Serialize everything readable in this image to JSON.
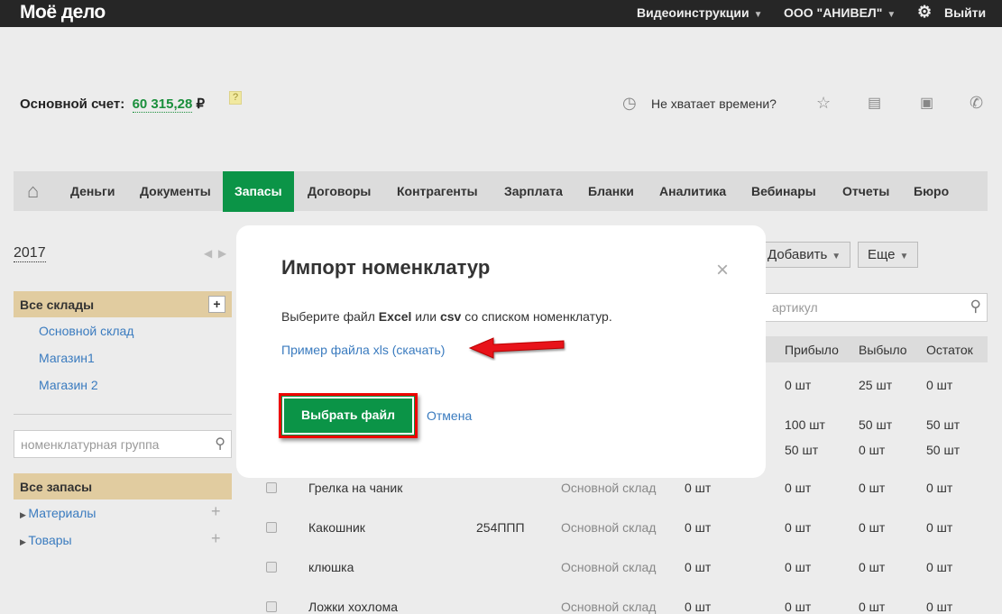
{
  "topbar": {
    "logo": "Моё дело",
    "video": "Видеоинструкции",
    "company": "ООО \"АНИВЕЛ\"",
    "logout": "Выйти"
  },
  "account": {
    "label": "Основной счет:",
    "amount": "60 315,28",
    "currency": "₽",
    "help": "?",
    "no_time": "Не хватает времени?"
  },
  "nav": [
    {
      "label": "Деньги"
    },
    {
      "label": "Документы"
    },
    {
      "label": "Запасы",
      "active": true
    },
    {
      "label": "Договоры"
    },
    {
      "label": "Контрагенты"
    },
    {
      "label": "Зарплата"
    },
    {
      "label": "Бланки"
    },
    {
      "label": "Аналитика"
    },
    {
      "label": "Вебинары"
    },
    {
      "label": "Отчеты"
    },
    {
      "label": "Бюро"
    }
  ],
  "sidebar": {
    "year": "2017",
    "warehouses_title": "Все склады",
    "warehouses": [
      "Основной склад",
      "Магазин1",
      "Магазин 2"
    ],
    "group_placeholder": "номенклатурная группа",
    "stock_title": "Все запасы",
    "tree": [
      "Материалы",
      "Товары"
    ]
  },
  "toolbar": {
    "add": "Добавить",
    "more": "Еще",
    "search_placeholder": "артикул"
  },
  "table": {
    "headers": [
      "Прибыло",
      "Выбыло",
      "Остаток"
    ],
    "partial_rows": [
      [
        "0 шт",
        "25 шт",
        "0 шт"
      ],
      [
        "100 шт",
        "50 шт",
        "50 шт"
      ],
      [
        "50 шт",
        "0 шт",
        "50 шт"
      ]
    ],
    "rows": [
      {
        "name": "Грелка на чаник",
        "article": "",
        "warehouse": "Основной склад",
        "start": "0 шт",
        "in": "0 шт",
        "out": "0 шт",
        "rest": "0 шт"
      },
      {
        "name": "Какошник",
        "article": "254ППП",
        "warehouse": "Основной склад",
        "start": "0 шт",
        "in": "0 шт",
        "out": "0 шт",
        "rest": "0 шт"
      },
      {
        "name": "клюшка",
        "article": "",
        "warehouse": "Основной склад",
        "start": "0 шт",
        "in": "0 шт",
        "out": "0 шт",
        "rest": "0 шт"
      },
      {
        "name": "Ложки хохлома",
        "article": "",
        "warehouse": "Основной склад",
        "start": "0 шт",
        "in": "0 шт",
        "out": "0 шт",
        "rest": "0 шт"
      }
    ]
  },
  "modal": {
    "title": "Импорт номенклатур",
    "desc_1": "Выберите файл ",
    "desc_excel": "Excel",
    "desc_2": " или ",
    "desc_csv": "csv",
    "desc_3": " со списком номенклатур.",
    "sample_link": "Пример файла xls (скачать)",
    "choose": "Выбрать файл",
    "cancel": "Отмена",
    "close": "×"
  }
}
